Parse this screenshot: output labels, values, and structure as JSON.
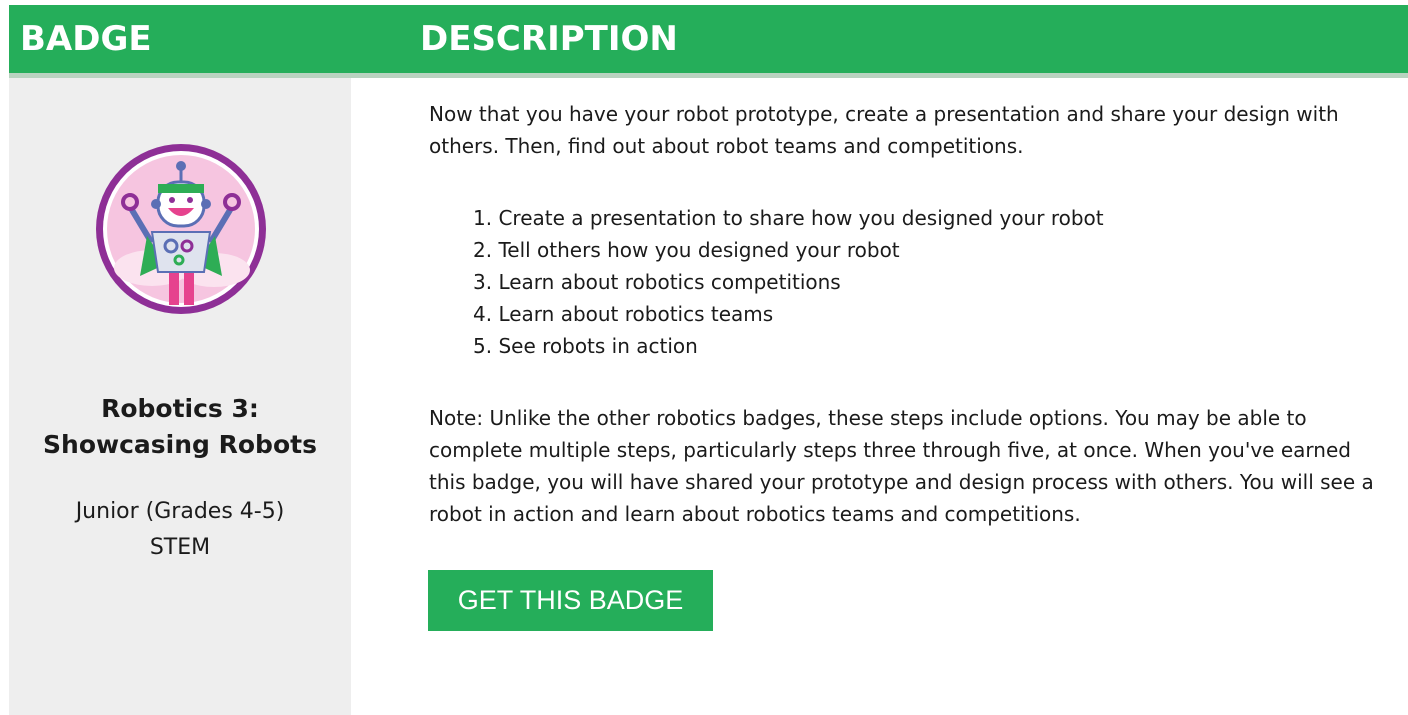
{
  "header": {
    "badge_col": "BADGE",
    "description_col": "DESCRIPTION"
  },
  "badge": {
    "icon": "robot-badge-icon",
    "title_line1": "Robotics 3:",
    "title_line2": "Showcasing Robots",
    "level": "Junior (Grades 4-5)",
    "category": "STEM"
  },
  "description": {
    "intro": "Now that you have your robot prototype, create a presentation and share your design with others. Then, find out about robot teams and competitions.",
    "steps": [
      "1. Create a presentation to share how you designed your robot",
      "2. Tell others how you designed your robot",
      "3. Learn about robotics competitions",
      "4. Learn about robotics teams",
      "5. See robots in action"
    ],
    "note": "Note: Unlike the other robotics badges, these steps include options. You may be able to complete multiple steps, particularly steps three through five, at once. When you've earned this badge, you will have shared your prototype and design process with others. You will see a robot in action and learn about robotics teams and competitions."
  },
  "cta": {
    "label": "GET THIS BADGE"
  },
  "colors": {
    "brand_green": "#25AE5A",
    "sidebar_bg": "#EEEEEE",
    "badge_ring": "#8E2F96",
    "badge_inner": "#F6C5E0"
  }
}
